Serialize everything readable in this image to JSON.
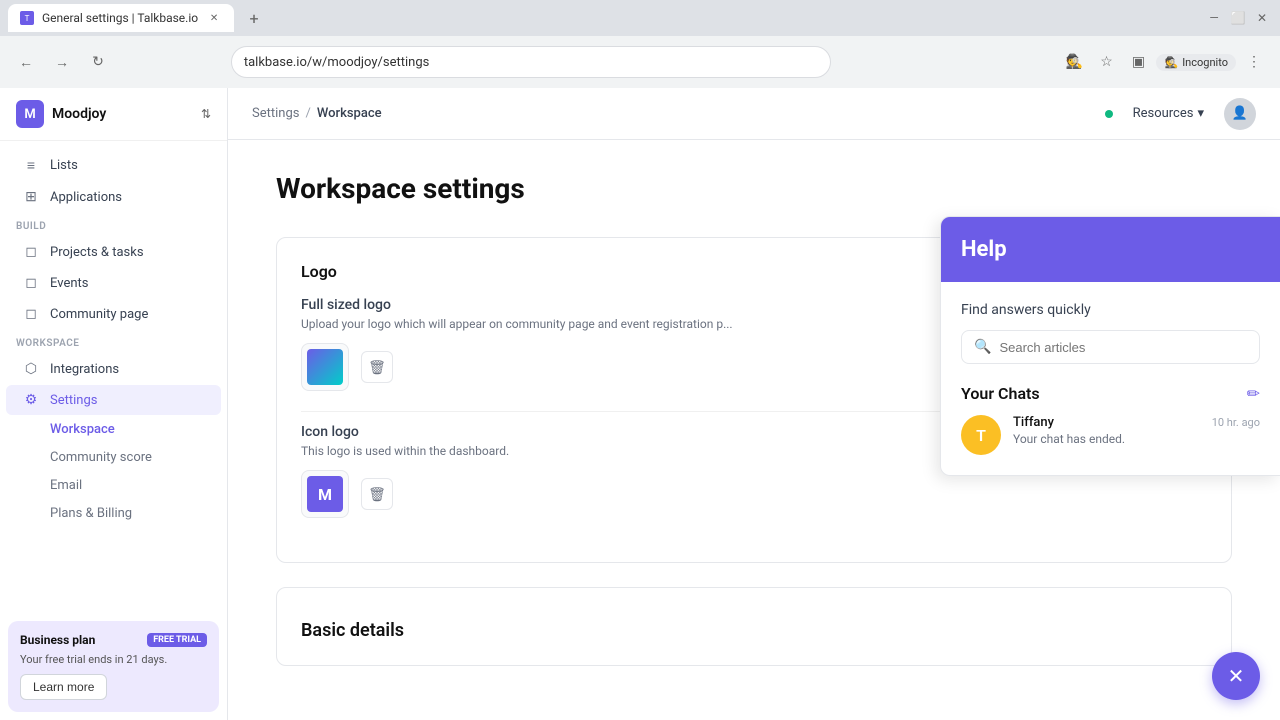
{
  "browser": {
    "tab_title": "General settings | Talkbase.io",
    "url": "talkbase.io/w/moodjoy/settings",
    "new_tab_label": "+",
    "back_icon": "←",
    "forward_icon": "→",
    "refresh_icon": "↻",
    "incognito_label": "Incognito"
  },
  "sidebar": {
    "workspace_initial": "M",
    "workspace_name": "Moodjoy",
    "nav_items": [
      {
        "id": "lists",
        "label": "Lists",
        "icon": "≡"
      },
      {
        "id": "applications",
        "label": "Applications",
        "icon": "⊞"
      }
    ],
    "build_section": "BUILD",
    "build_items": [
      {
        "id": "projects",
        "label": "Projects & tasks",
        "icon": "◻"
      },
      {
        "id": "events",
        "label": "Events",
        "icon": "◻"
      },
      {
        "id": "community",
        "label": "Community page",
        "icon": "◻"
      }
    ],
    "workspace_section": "WORKSPACE",
    "workspace_items": [
      {
        "id": "integrations",
        "label": "Integrations",
        "icon": "⬡"
      },
      {
        "id": "settings",
        "label": "Settings",
        "icon": "⚙"
      }
    ],
    "settings_sub_items": [
      {
        "id": "workspace",
        "label": "Workspace",
        "active": true
      },
      {
        "id": "community-score",
        "label": "Community score",
        "active": false
      },
      {
        "id": "email",
        "label": "Email",
        "active": false
      },
      {
        "id": "plans-billing",
        "label": "Plans & Billing",
        "active": false
      }
    ],
    "business_plan": {
      "label": "Business plan",
      "badge": "FREE TRIAL",
      "trial_text": "Your free trial ends in 21 days.",
      "learn_more": "Learn more"
    }
  },
  "header": {
    "breadcrumb_settings": "Settings",
    "breadcrumb_sep": "/",
    "breadcrumb_current": "Workspace",
    "resources_label": "Resources",
    "chevron_down": "▾"
  },
  "main": {
    "page_title": "Workspace settings",
    "logo_section_title": "Logo",
    "full_logo": {
      "label": "Full sized logo",
      "description": "Upload your logo which will appear on community page and event registration p..."
    },
    "icon_logo": {
      "label": "Icon logo",
      "description": "This logo is used within the dashboard.",
      "letter": "M"
    },
    "basic_details_title": "Basic details"
  },
  "help": {
    "title": "Help",
    "find_text": "Find answers quickly",
    "search_placeholder": "Search articles",
    "chats_title": "Your Chats",
    "chat_item": {
      "name": "Tiffany",
      "time": "10 hr. ago",
      "preview": "Your chat has ended."
    }
  },
  "icons": {
    "search": "🔍",
    "delete": "🗑",
    "new_chat": "✏",
    "close": "✕",
    "chevron": "⌃"
  }
}
